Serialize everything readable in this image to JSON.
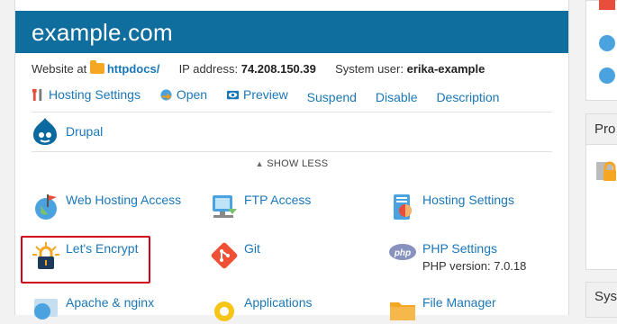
{
  "header": {
    "title": "example.com"
  },
  "info": {
    "website_at_label": "Website at",
    "folder_link": "httpdocs/",
    "ip_label": "IP address:",
    "ip_value": "74.208.150.39",
    "user_label": "System user:",
    "user_value": "erika-example"
  },
  "actions": {
    "hosting_settings": "Hosting Settings",
    "open": "Open",
    "preview": "Preview",
    "suspend": "Suspend",
    "disable": "Disable",
    "description": "Description"
  },
  "drupal": {
    "label": "Drupal"
  },
  "show_less": "SHOW LESS",
  "tiles": {
    "web_hosting_access": "Web Hosting Access",
    "ftp_access": "FTP Access",
    "hosting_settings": "Hosting Settings",
    "lets_encrypt": "Let's Encrypt",
    "git": "Git",
    "php_settings": "PHP Settings",
    "php_version": "PHP version: 7.0.18",
    "apache_nginx": "Apache & nginx",
    "applications": "Applications",
    "file_manager": "File Manager"
  },
  "sidebar": {
    "panel2_title": "Pro",
    "panel3_title": "Syst"
  },
  "colors": {
    "header_bg": "#0f6e9e",
    "link": "#1a77b8",
    "highlight": "#d0021b"
  }
}
